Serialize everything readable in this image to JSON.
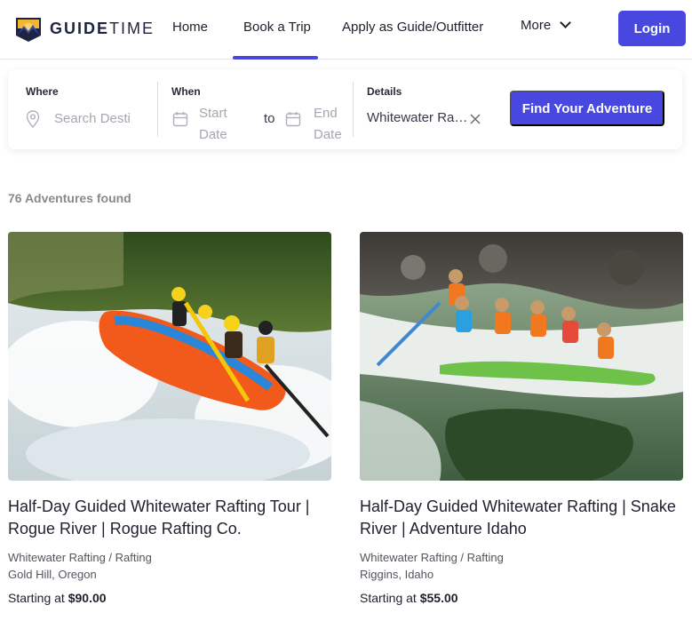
{
  "header": {
    "logo": {
      "text_bold": "GUIDE",
      "text_thin": "TIME"
    },
    "nav": [
      {
        "label": "Home"
      },
      {
        "label": "Book a Trip",
        "active": true
      },
      {
        "label": "Apply as Guide/Outfitter"
      },
      {
        "label": "More"
      }
    ],
    "login_label": "Login"
  },
  "search": {
    "where_label": "Where",
    "where_placeholder": "Search Desti",
    "when_label": "When",
    "start_placeholder_line1": "Start",
    "start_placeholder_line2": "Date",
    "to_label": "to",
    "end_placeholder_line1": "End",
    "end_placeholder_line2": "Date",
    "details_label": "Details",
    "details_value": "Whitewater Rafting",
    "find_label": "Find Your Adventure"
  },
  "results": {
    "count_text": "76 Adventures found"
  },
  "cards": [
    {
      "title": "Half-Day Guided Whitewater Rafting Tour | Rogue River | Rogue Rafting Co.",
      "category": "Whitewater Rafting / Rafting",
      "location": "Gold Hill, Oregon",
      "price_prefix": "Starting at",
      "price": "$90.00"
    },
    {
      "title": "Half-Day Guided Whitewater Rafting | Snake River | Adventure Idaho",
      "category": "Whitewater Rafting / Rafting",
      "location": "Riggins, Idaho",
      "price_prefix": "Starting at",
      "price": "$55.00"
    }
  ],
  "colors": {
    "accent": "#4848e0",
    "logo_navy": "#1d2340",
    "logo_gold": "#f2b632"
  }
}
